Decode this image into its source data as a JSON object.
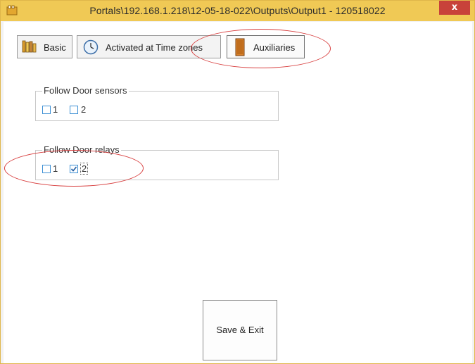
{
  "window": {
    "title": "Portals\\192.168.1.218\\12-05-18-022\\Outputs\\Output1 - 120518022",
    "close_label": "x",
    "icon": "folder-app-icon"
  },
  "tabs": [
    {
      "label": "Basic",
      "icon": "books-icon",
      "active": false
    },
    {
      "label": "Activated at Time zones",
      "icon": "clock-icon",
      "active": false
    },
    {
      "label": "Auxiliaries",
      "icon": "door-icon",
      "active": true
    }
  ],
  "groups": {
    "door_sensors": {
      "title": "Follow Door sensors",
      "items": [
        {
          "label": "1",
          "checked": false
        },
        {
          "label": "2",
          "checked": false
        }
      ]
    },
    "door_relays": {
      "title": "Follow Door relays",
      "items": [
        {
          "label": "1",
          "checked": false
        },
        {
          "label": "2",
          "checked": true
        }
      ]
    }
  },
  "actions": {
    "save_exit_label": "Save & Exit"
  },
  "colors": {
    "titlebar": "#f0c955",
    "close": "#c8423a",
    "checkbox_border": "#3c8fd4",
    "annotation": "#d84040"
  }
}
